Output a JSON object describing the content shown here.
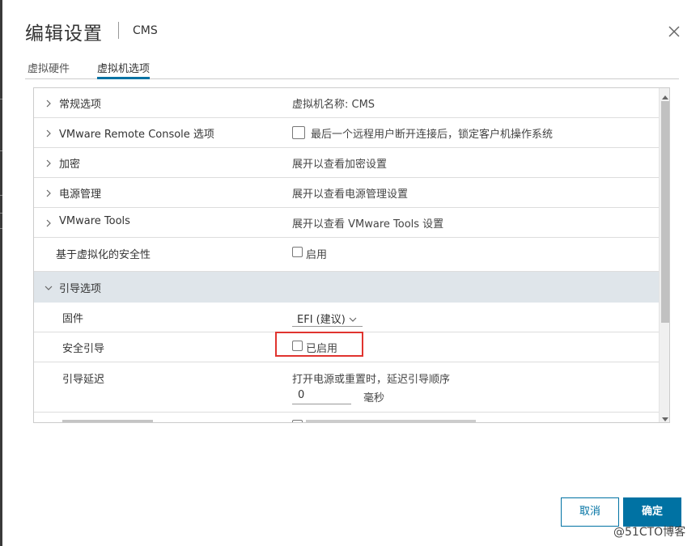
{
  "dialog": {
    "title": "编辑设置",
    "vm_name": "CMS",
    "tabs": [
      {
        "label": "虚拟硬件",
        "active": false
      },
      {
        "label": "虚拟机选项",
        "active": true
      }
    ]
  },
  "options": {
    "general": {
      "label": "常规选项",
      "value": "虚拟机名称: CMS"
    },
    "vmrc": {
      "label": "VMware Remote Console 选项",
      "value": "最后一个远程用户断开连接后，锁定客户机操作系统",
      "checked": false
    },
    "encryption": {
      "label": "加密",
      "value": "展开以查看加密设置"
    },
    "power": {
      "label": "电源管理",
      "value": "展开以查看电源管理设置"
    },
    "tools": {
      "label": "VMware Tools",
      "value": "展开以查看 VMware Tools 设置"
    },
    "vbs": {
      "label": "基于虚拟化的安全性",
      "value": "启用",
      "checked": false
    },
    "boot": {
      "label": "引导选项",
      "firmware": {
        "label": "固件",
        "value": "EFI (建议)"
      },
      "secure_boot": {
        "label": "安全引导",
        "value": "已启用",
        "checked": false
      },
      "delay": {
        "label": "引导延迟",
        "description": "打开电源或重置时，延迟引导顺序",
        "value": "0",
        "unit": "毫秒"
      }
    }
  },
  "buttons": {
    "cancel": "取消",
    "ok": "确定"
  },
  "watermark": "@51CTO博客",
  "colors": {
    "accent": "#0072a3",
    "highlight_box": "#e0342f",
    "section_bg": "#dfe5ea"
  }
}
